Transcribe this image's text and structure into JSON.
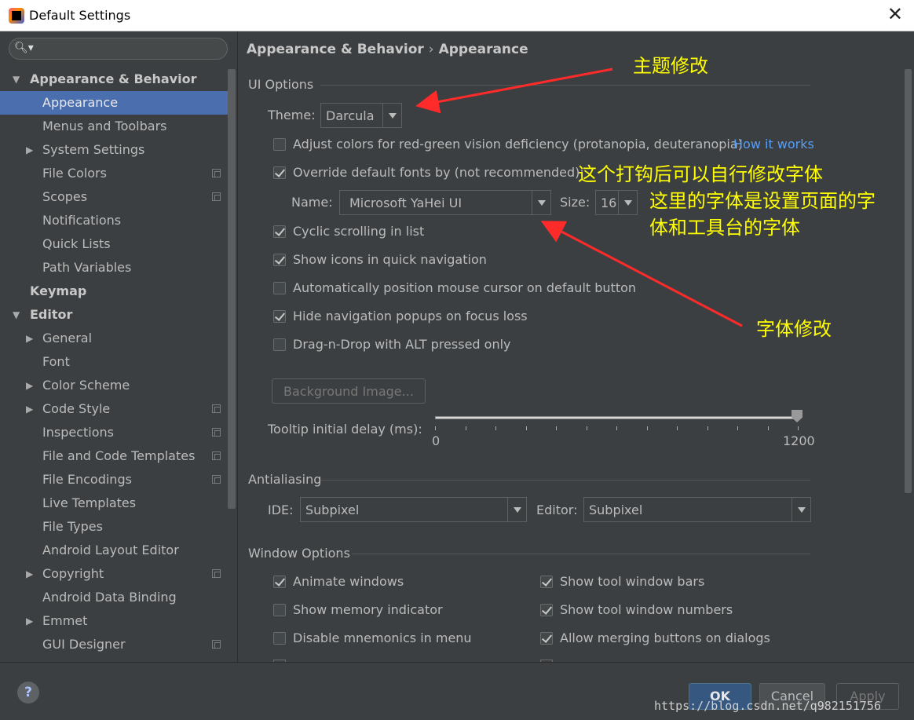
{
  "window": {
    "title": "Default Settings",
    "close_glyph": "✕"
  },
  "search": {
    "placeholder": ""
  },
  "sidebar": {
    "items": [
      {
        "label": "Appearance & Behavior",
        "level": 0,
        "arrow": "expanded",
        "bold": true
      },
      {
        "label": "Appearance",
        "level": 1,
        "selected": true
      },
      {
        "label": "Menus and Toolbars",
        "level": 1
      },
      {
        "label": "System Settings",
        "level": 1,
        "arrow": "collapsed"
      },
      {
        "label": "File Colors",
        "level": 1,
        "copy": true
      },
      {
        "label": "Scopes",
        "level": 1,
        "copy": true
      },
      {
        "label": "Notifications",
        "level": 1
      },
      {
        "label": "Quick Lists",
        "level": 1
      },
      {
        "label": "Path Variables",
        "level": 1
      },
      {
        "label": "Keymap",
        "level": 0,
        "bold": true
      },
      {
        "label": "Editor",
        "level": 0,
        "arrow": "expanded",
        "bold": true
      },
      {
        "label": "General",
        "level": 1,
        "arrow": "collapsed"
      },
      {
        "label": "Font",
        "level": 1
      },
      {
        "label": "Color Scheme",
        "level": 1,
        "arrow": "collapsed"
      },
      {
        "label": "Code Style",
        "level": 1,
        "arrow": "collapsed",
        "copy": true
      },
      {
        "label": "Inspections",
        "level": 1,
        "copy": true
      },
      {
        "label": "File and Code Templates",
        "level": 1,
        "copy": true
      },
      {
        "label": "File Encodings",
        "level": 1,
        "copy": true
      },
      {
        "label": "Live Templates",
        "level": 1
      },
      {
        "label": "File Types",
        "level": 1
      },
      {
        "label": "Android Layout Editor",
        "level": 1
      },
      {
        "label": "Copyright",
        "level": 1,
        "arrow": "collapsed",
        "copy": true
      },
      {
        "label": "Android Data Binding",
        "level": 1
      },
      {
        "label": "Emmet",
        "level": 1,
        "arrow": "collapsed"
      },
      {
        "label": "GUI Designer",
        "level": 1,
        "copy": true
      }
    ]
  },
  "breadcrumb": {
    "parent": "Appearance & Behavior",
    "separator": "›",
    "current": "Appearance"
  },
  "ui_options": {
    "title": "UI Options",
    "theme_label": "Theme:",
    "theme_value": "Darcula",
    "adjust_colors": {
      "label": "Adjust colors for red-green vision deficiency (protanopia, deuteranopia)",
      "checked": false
    },
    "how_it_works": "How it works",
    "override_fonts": {
      "label": "Override default fonts by (not recommended):",
      "checked": true
    },
    "name_label": "Name:",
    "name_value": "Microsoft YaHei UI",
    "size_label": "Size:",
    "size_value": "16",
    "cyclic": {
      "label": "Cyclic scrolling in list",
      "checked": true
    },
    "show_icons": {
      "label": "Show icons in quick navigation",
      "checked": true
    },
    "auto_position": {
      "label": "Automatically position mouse cursor on default button",
      "checked": false
    },
    "hide_nav": {
      "label": "Hide navigation popups on focus loss",
      "checked": true
    },
    "drag_drop": {
      "label": "Drag-n-Drop with ALT pressed only",
      "checked": false
    },
    "background_button": "Background Image...",
    "tooltip_label": "Tooltip initial delay (ms):",
    "tooltip_min": "0",
    "tooltip_max": "1200",
    "tooltip_value": 1200
  },
  "antialiasing": {
    "title": "Antialiasing",
    "ide_label": "IDE:",
    "ide_value": "Subpixel",
    "editor_label": "Editor:",
    "editor_value": "Subpixel"
  },
  "window_options": {
    "title": "Window Options",
    "animate": {
      "label": "Animate windows",
      "checked": true
    },
    "memory": {
      "label": "Show memory indicator",
      "checked": false
    },
    "mnemonics_menu": {
      "label": "Disable mnemonics in menu",
      "checked": false
    },
    "tool_bars": {
      "label": "Show tool window bars",
      "checked": true
    },
    "tool_numbers": {
      "label": "Show tool window numbers",
      "checked": true
    },
    "merge_buttons": {
      "label": "Allow merging buttons on dialogs",
      "checked": true
    }
  },
  "annotations": {
    "theme": "主题修改",
    "override_1": "这个打钩后可以自行修改字体",
    "override_2": "这里的字体是设置页面的字",
    "override_3": "体和工具台的字体",
    "font": "字体修改"
  },
  "footer": {
    "help": "?",
    "ok": "OK",
    "cancel": "Cancel",
    "apply": "Apply",
    "watermark": "https://blog.csdn.net/q982151756"
  },
  "colors": {
    "accent_selected": "#4b6eaf",
    "annotation": "#ffff00",
    "arrow": "#ff2a2a",
    "link": "#589df6"
  }
}
